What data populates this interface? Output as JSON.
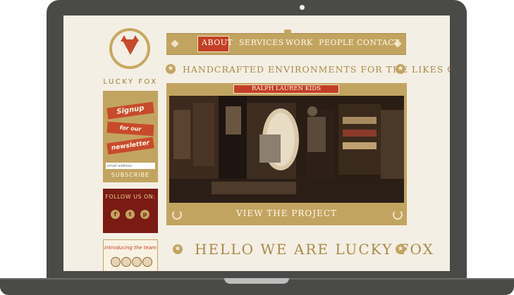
{
  "brand": {
    "name": "LUCKY FOX"
  },
  "nav": {
    "items": [
      "ABOUT",
      "SERVICES",
      "WORK",
      "PEOPLE",
      "CONTACT"
    ],
    "active": "ABOUT"
  },
  "tagline": "HANDCRAFTED ENVIRONMENTS FOR THE LIKES OF",
  "project": {
    "label": "RALPH LAUREN KIDS",
    "cta": "VIEW THE PROJECT"
  },
  "signup": {
    "line1": "Signup",
    "line2": "for our",
    "line3": "newsletter",
    "placeholder": "email address",
    "button": "SUBSCRIBE"
  },
  "follow": {
    "title": "FOLLOW US ON:",
    "icons": [
      "facebook-icon",
      "twitter-icon",
      "pinterest-icon"
    ]
  },
  "team": {
    "title": "introducing the team"
  },
  "headline": "HELLO WE ARE LUCKY FOX",
  "colors": {
    "gold": "#c2a461",
    "red": "#c33f25",
    "maroon": "#7a1b14",
    "background": "#f4efe4",
    "frame": "#4a4a48"
  }
}
